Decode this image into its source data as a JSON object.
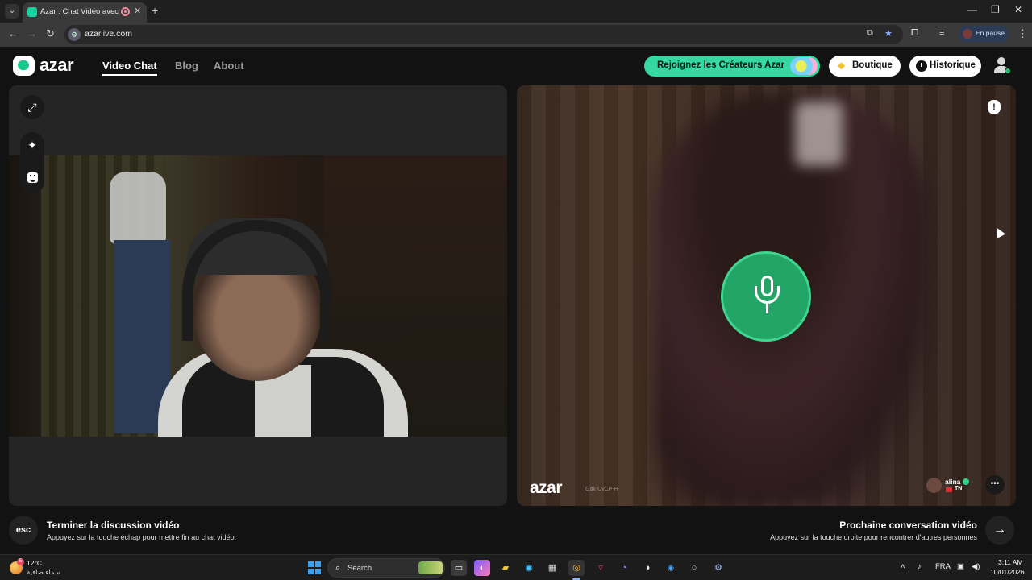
{
  "browser": {
    "tab_title": "Azar : Chat Vidéo avec des inconnus",
    "tab_close": "✕",
    "new_tab": "+",
    "url": "azarlive.com",
    "profile_status": "En pause",
    "window_controls": {
      "minimize": "—",
      "restore": "❐",
      "close": "✕"
    }
  },
  "header": {
    "logo_text": "azar",
    "nav": {
      "video_chat": "Video Chat",
      "blog": "Blog",
      "about": "About"
    },
    "creators_label": "Rejoignez les Créateurs Azar",
    "shop_label": "Boutique",
    "history_label": "Historique"
  },
  "peer": {
    "name": "alina",
    "country": "TN",
    "watermark_logo": "azar",
    "watermark_id": "Gak-UvCP-H"
  },
  "footer": {
    "esc_key": "esc",
    "end_title": "Terminer la discussion vidéo",
    "end_hint": "Appuyez sur la touche échap pour mettre fin au chat vidéo.",
    "next_title": "Prochaine conversation vidéo",
    "next_hint": "Appuyez sur la touche droite pour rencontrer d'autres personnes"
  },
  "taskbar": {
    "temperature": "12°C",
    "condition": "سماء صافية",
    "search_label": "Search",
    "language": "FRA",
    "time": "3:11 AM",
    "date": "10/01/2026"
  },
  "colors": {
    "accent_green": "#23a568",
    "creators_pill": "#34d8a0"
  }
}
